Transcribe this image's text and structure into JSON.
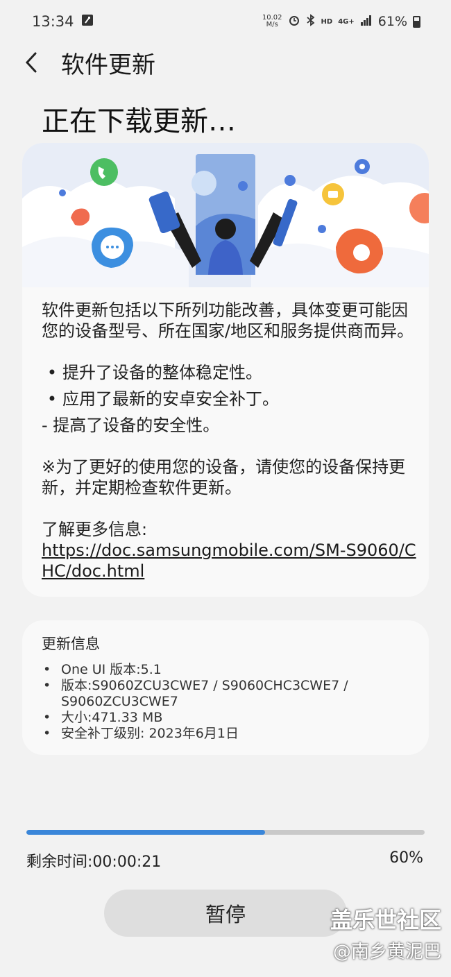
{
  "status_bar": {
    "time": "13:34",
    "net_speed_value": "10.02",
    "net_speed_unit": "M/s",
    "hd_label": "HD",
    "network_label": "4G+",
    "battery_percent": "61%"
  },
  "header": {
    "title": "软件更新"
  },
  "page_title": "正在下载更新…",
  "description": {
    "intro": "软件更新包括以下所列功能改善，具体变更可能因您的设备型号、所在国家/地区和服务提供商而异。",
    "bullets": [
      "提升了设备的整体稳定性。",
      "应用了最新的安卓安全补丁。"
    ],
    "bullet_mark": "•",
    "dash_line": "- 提高了设备的安全性。",
    "note": "※为了更好的使用您的设备，请使您的设备保持更新，并定期检查软件更新。",
    "more_info_label": "了解更多信息:",
    "link": "https://doc.samsungmobile.com/SM-S9060/CHC/doc.html"
  },
  "update_info": {
    "title": "更新信息",
    "items": [
      "One UI 版本:5.1",
      "版本:S9060ZCU3CWE7 / S9060CHC3CWE7 / S9060ZCU3CWE7",
      "大小:471.33 MB",
      "安全补丁级别: 2023年6月1日"
    ]
  },
  "progress": {
    "fraction": 0.6,
    "remaining_time": "剩余时间:00:00:21",
    "percent_text": "60%"
  },
  "pause_label": "暂停",
  "watermark": {
    "line1": "盖乐世社区",
    "line2": "@南乡黄泥巴"
  },
  "colors": {
    "progress": "#3a86d9",
    "background": "#f2f2f2",
    "card": "#f9f9f9"
  }
}
